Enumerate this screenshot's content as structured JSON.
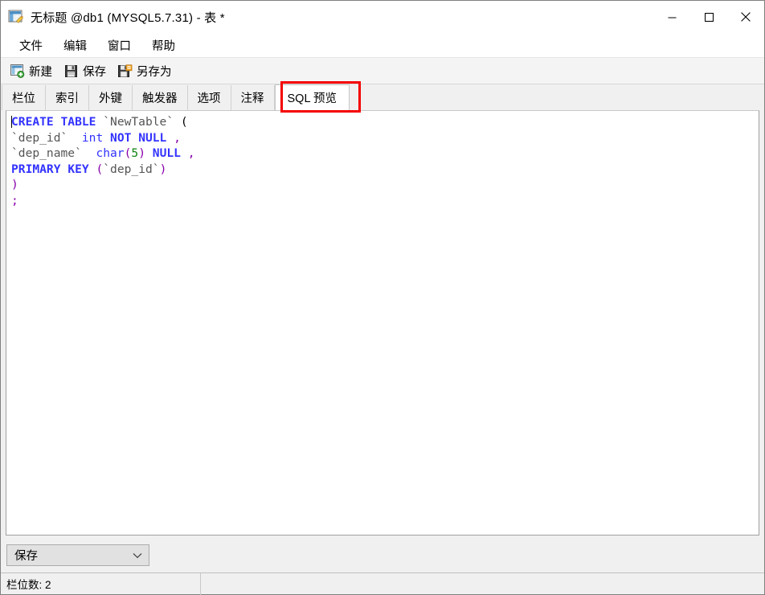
{
  "window": {
    "title": "无标题 @db1 (MYSQL5.7.31) - 表 *",
    "icon": "table-edit-icon",
    "controls": {
      "minimize": "minimize-icon",
      "maximize": "maximize-icon",
      "close": "close-icon"
    }
  },
  "menubar": {
    "items": [
      {
        "label": "文件"
      },
      {
        "label": "编辑"
      },
      {
        "label": "窗口"
      },
      {
        "label": "帮助"
      }
    ]
  },
  "toolbar": {
    "items": [
      {
        "label": "新建",
        "icon": "new-table-icon"
      },
      {
        "label": "保存",
        "icon": "save-icon"
      },
      {
        "label": "另存为",
        "icon": "save-as-icon"
      }
    ]
  },
  "tabs": {
    "items": [
      {
        "label": "栏位",
        "active": false
      },
      {
        "label": "索引",
        "active": false
      },
      {
        "label": "外键",
        "active": false
      },
      {
        "label": "触发器",
        "active": false
      },
      {
        "label": "选项",
        "active": false
      },
      {
        "label": "注释",
        "active": false
      },
      {
        "label": "SQL 预览",
        "active": true
      }
    ],
    "annotation_color": "#f50000"
  },
  "editor": {
    "lines": [
      "CREATE TABLE `NewTable` (",
      "`dep_id`  int NOT NULL ,",
      "`dep_name`  char(5) NULL ,",
      "PRIMARY KEY (`dep_id`)",
      ")",
      ";"
    ],
    "tokens": {
      "l1_kw1": "CREATE",
      "l1_kw2": "TABLE",
      "l1_id": "`NewTable`",
      "l1_paren": "(",
      "l2_id": "`dep_id`",
      "l2_type": "int",
      "l2_kw1": "NOT",
      "l2_kw2": "NULL",
      "l2_comma": ",",
      "l3_id": "`dep_name`",
      "l3_type": "char",
      "l3_open": "(",
      "l3_num": "5",
      "l3_close": ")",
      "l3_kw": "NULL",
      "l3_comma": ",",
      "l4_kw1": "PRIMARY",
      "l4_kw2": "KEY",
      "l4_open": "(",
      "l4_id": "`dep_id`",
      "l4_close": ")",
      "l5": ")",
      "l6": ";"
    }
  },
  "bottom": {
    "save_combo_value": "保存",
    "chevron": "chevron-down-icon"
  },
  "statusbar": {
    "field_count_label": "栏位数: 2",
    "right_cell": ""
  },
  "colors": {
    "keyword": "#3333ff",
    "identifier": "#555555",
    "number": "#108010",
    "punctuation": "#8800aa",
    "annotation": "#f50000",
    "window_bg": "#f0f0f0"
  }
}
